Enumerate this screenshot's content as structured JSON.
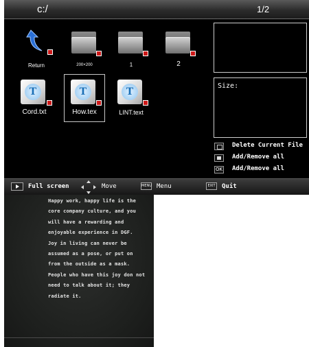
{
  "header": {
    "path": "c:/",
    "page": "1/2"
  },
  "files": [
    {
      "name": "Return",
      "icon": "return-arrow-icon"
    },
    {
      "name": "200×200",
      "icon": "folder-icon"
    },
    {
      "name": "1",
      "icon": "folder-icon"
    },
    {
      "name": "2",
      "icon": "folder-icon"
    },
    {
      "name": "Cord.txt",
      "icon": "text-document-icon"
    },
    {
      "name": "How.tex",
      "icon": "text-document-icon"
    },
    {
      "name": "LINT.text",
      "icon": "text-document-icon"
    }
  ],
  "info": {
    "size_label": "Size:"
  },
  "options": [
    {
      "key": "",
      "label": "Delete Current File"
    },
    {
      "key": "",
      "label": "Add/Remove all"
    },
    {
      "key": "OK",
      "label": "Add/Remove all"
    }
  ],
  "bottom_bar": {
    "fullscreen": "Full screen",
    "move": "Move",
    "menu_key": "MENU",
    "menu": "Menu",
    "exit_key": "EXIT",
    "quit": "Quit"
  },
  "photo_text": [
    "Happy work, happy life is the",
    "core company culture, and you",
    "will have a rewarding and",
    "enjoyable experience in DGF.",
    "Joy in living can never be",
    "assumed as a pose, or put on",
    "from the outside as a mask.",
    "People who have this joy don not",
    "need to talk about it; they",
    "radiate it."
  ],
  "colors": {
    "badge": "#cc1818",
    "return_icon": "#2a6fd6"
  }
}
